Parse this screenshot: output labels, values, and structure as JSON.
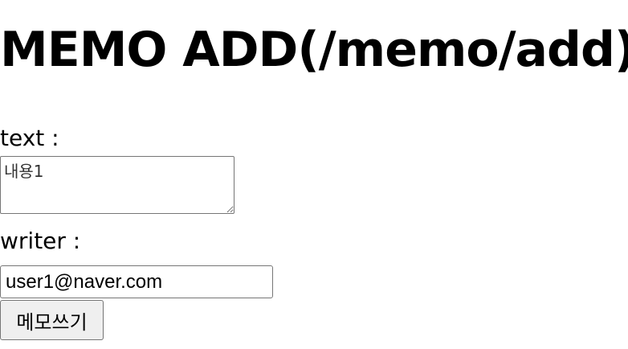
{
  "page": {
    "title": "MEMO ADD(/memo/add)"
  },
  "form": {
    "text_label": "text :",
    "text_value": "내용1",
    "writer_label": "writer :",
    "writer_value": "user1@naver.com",
    "submit_label": "메모쓰기"
  }
}
